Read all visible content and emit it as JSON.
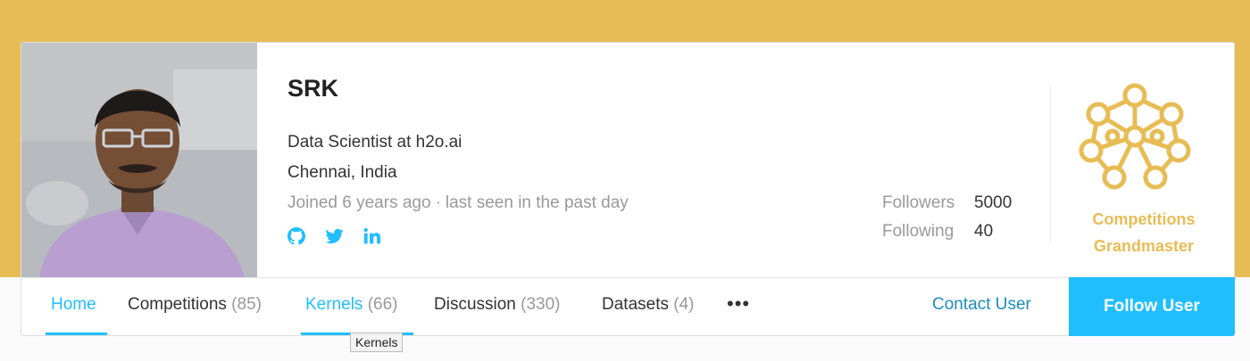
{
  "profile": {
    "name": "SRK",
    "occupation": "Data Scientist at h2o.ai",
    "location": "Chennai, India",
    "joined": "Joined 6 years ago",
    "separator": "·",
    "last_seen": "last seen in the past day",
    "socials": [
      "github-icon",
      "twitter-icon",
      "linkedin-icon"
    ],
    "socials_color": "#20beff"
  },
  "stats": {
    "followers_label": "Followers",
    "followers_value": "5000",
    "following_label": "Following",
    "following_value": "40"
  },
  "tier": {
    "line1": "Competitions",
    "line2": "Grandmaster",
    "color": "#e8bc55"
  },
  "nav": {
    "home": "Home",
    "competitions": "Competitions",
    "competitions_count": "(85)",
    "kernels": "Kernels",
    "kernels_count": "(66)",
    "discussion": "Discussion",
    "discussion_count": "(330)",
    "datasets": "Datasets",
    "datasets_count": "(4)",
    "more": "•••",
    "active_color": "#20beff"
  },
  "actions": {
    "contact": "Contact User",
    "follow": "Follow User"
  },
  "tooltip": "Kernels",
  "colors": {
    "banner": "#e8bc55",
    "accent": "#20beff"
  }
}
